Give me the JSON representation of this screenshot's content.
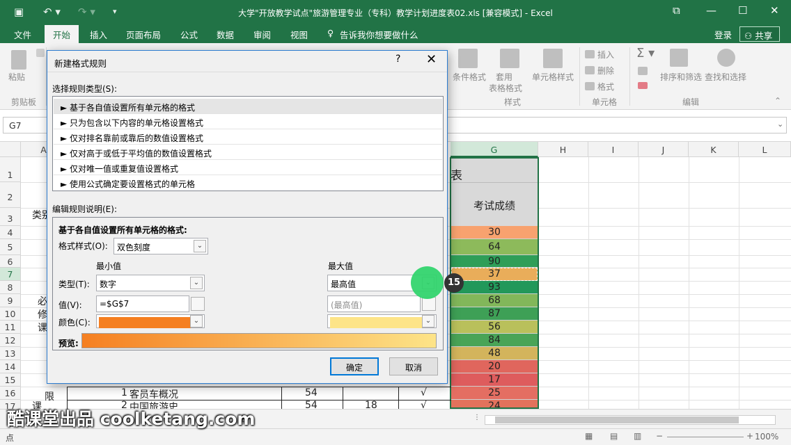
{
  "window": {
    "title": "大学\"开放教学试点\"旅游管理专业（专科）教学计划进度表02.xls  [兼容模式] - Excel"
  },
  "tabs": [
    "文件",
    "开始",
    "插入",
    "页面布局",
    "公式",
    "数据",
    "审阅",
    "视图"
  ],
  "tell_me": "告诉我你想要做什么",
  "login": "登录",
  "share": "共享",
  "ribbon": {
    "paste": "粘贴",
    "clipboard": "剪贴板",
    "cond_format": "条件格式",
    "table_format": "套用\n表格格式",
    "table_format_1": "套用",
    "table_format_2": "表格格式",
    "cell_style": "单元格样式",
    "styles_group": "样式",
    "insert": "插入",
    "delete": "删除",
    "format": "格式",
    "cells_group": "单元格",
    "sort_filter": "排序和筛选",
    "find_select": "查找和选择",
    "edit_group": "编辑"
  },
  "name_box": "G7",
  "columns": [
    "A",
    "G",
    "H",
    "I",
    "J",
    "K",
    "L"
  ],
  "rows": [
    "1",
    "2",
    "3",
    "4",
    "5",
    "6",
    "7",
    "8",
    "9",
    "10",
    "11",
    "12",
    "13",
    "14",
    "15",
    "16",
    "17"
  ],
  "sheet": {
    "title_fragment": "表",
    "g_header": "考试成绩",
    "category_label": "类别",
    "col_a_1": "必",
    "col_a_2": "修",
    "col_a_3": "课",
    "col_a_4": "限",
    "col_a_5": "课",
    "g_values": [
      "30",
      "64",
      "90",
      "37",
      "93",
      "68",
      "87",
      "56",
      "84",
      "48",
      "20",
      "17",
      "25",
      "24"
    ],
    "g_colors": [
      "#f8a26f",
      "#8dba5b",
      "#2f9e58",
      "#e9ad5a",
      "#22985a",
      "#82b75a",
      "#3ea056",
      "#b9c05b",
      "#49a457",
      "#d3b45c",
      "#e0665d",
      "#de5c5d",
      "#e46e62",
      "#e2725c"
    ],
    "row16": {
      "num": "1",
      "name": "客员车概况",
      "hours": "54",
      "mark": "√"
    },
    "row17": {
      "num": "2",
      "name": "中国旅游史",
      "hours": "54",
      "credit": "18",
      "mark": "√"
    }
  },
  "dialog": {
    "title": "新建格式规则",
    "help": "?",
    "close": "✕",
    "select_type_label": "选择规则类型(S):",
    "rule_types": [
      "► 基于各自值设置所有单元格的格式",
      "► 只为包含以下内容的单元格设置格式",
      "► 仅对排名靠前或靠后的数值设置格式",
      "► 仅对高于或低于平均值的数值设置格式",
      "► 仅对唯一值或重复值设置格式",
      "► 使用公式确定要设置格式的单元格"
    ],
    "edit_desc_label": "编辑规则说明(E):",
    "desc_heading": "基于各自值设置所有单元格的格式:",
    "format_style_label": "格式样式(O):",
    "format_style_value": "双色刻度",
    "min_label": "最小值",
    "max_label": "最大值",
    "type_label": "类型(T):",
    "min_type": "数字",
    "max_type": "最高值",
    "value_label": "值(V):",
    "min_value": "=$G$7",
    "max_value": "(最高值)",
    "color_label": "颜色(C):",
    "min_color": "#f57f21",
    "max_color": "#fde488",
    "preview_label": "预览:",
    "ok": "确定",
    "cancel": "取消"
  },
  "step_badge": "15",
  "status": {
    "mode": "点",
    "zoom": "100%"
  },
  "watermark": "酷课堂出品 coolketang.com"
}
